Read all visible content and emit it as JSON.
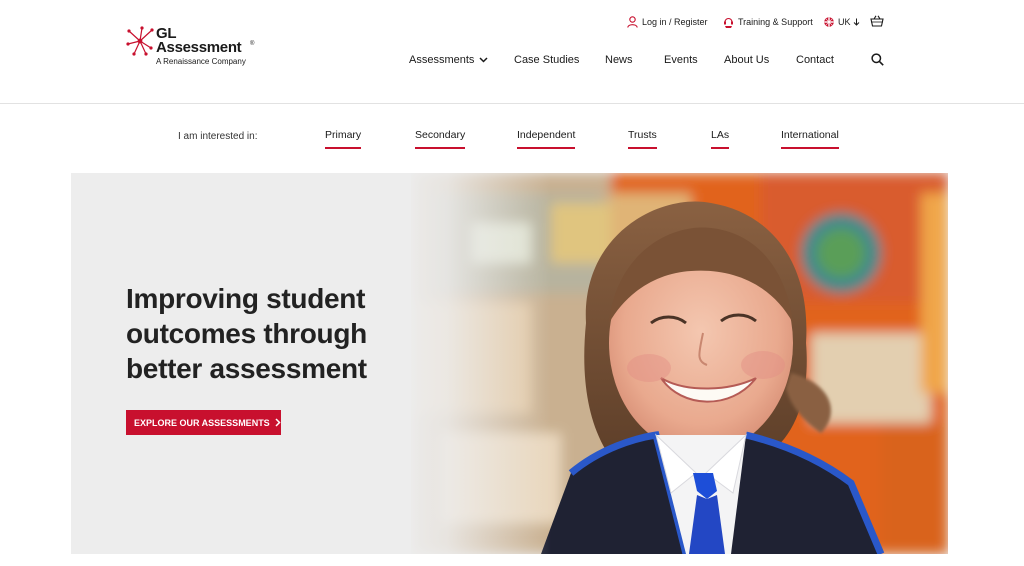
{
  "logo": {
    "line1": "GL",
    "line2": "Assessment",
    "trademark": "®",
    "tagline": "A Renaissance Company"
  },
  "utility": {
    "login": "Log in / Register",
    "training": "Training & Support",
    "region": "UK"
  },
  "nav": {
    "assessments": "Assessments",
    "case_studies": "Case Studies",
    "news": "News",
    "events": "Events",
    "about": "About Us",
    "contact": "Contact"
  },
  "interest": {
    "label": "I am interested in:",
    "links": [
      "Primary",
      "Secondary",
      "Independent",
      "Trusts",
      "LAs",
      "International"
    ]
  },
  "hero": {
    "title": "Improving student outcomes through better assessment",
    "cta": "EXPLORE OUR ASSESSMENTS"
  },
  "colors": {
    "accent": "#c8102e",
    "text": "#1a1a1a",
    "hero_bg": "#ededed"
  },
  "icons": [
    "person-icon",
    "support-icon",
    "uk-flag-icon",
    "basket-icon",
    "chevron-down-icon",
    "search-icon",
    "chevron-right-icon"
  ]
}
